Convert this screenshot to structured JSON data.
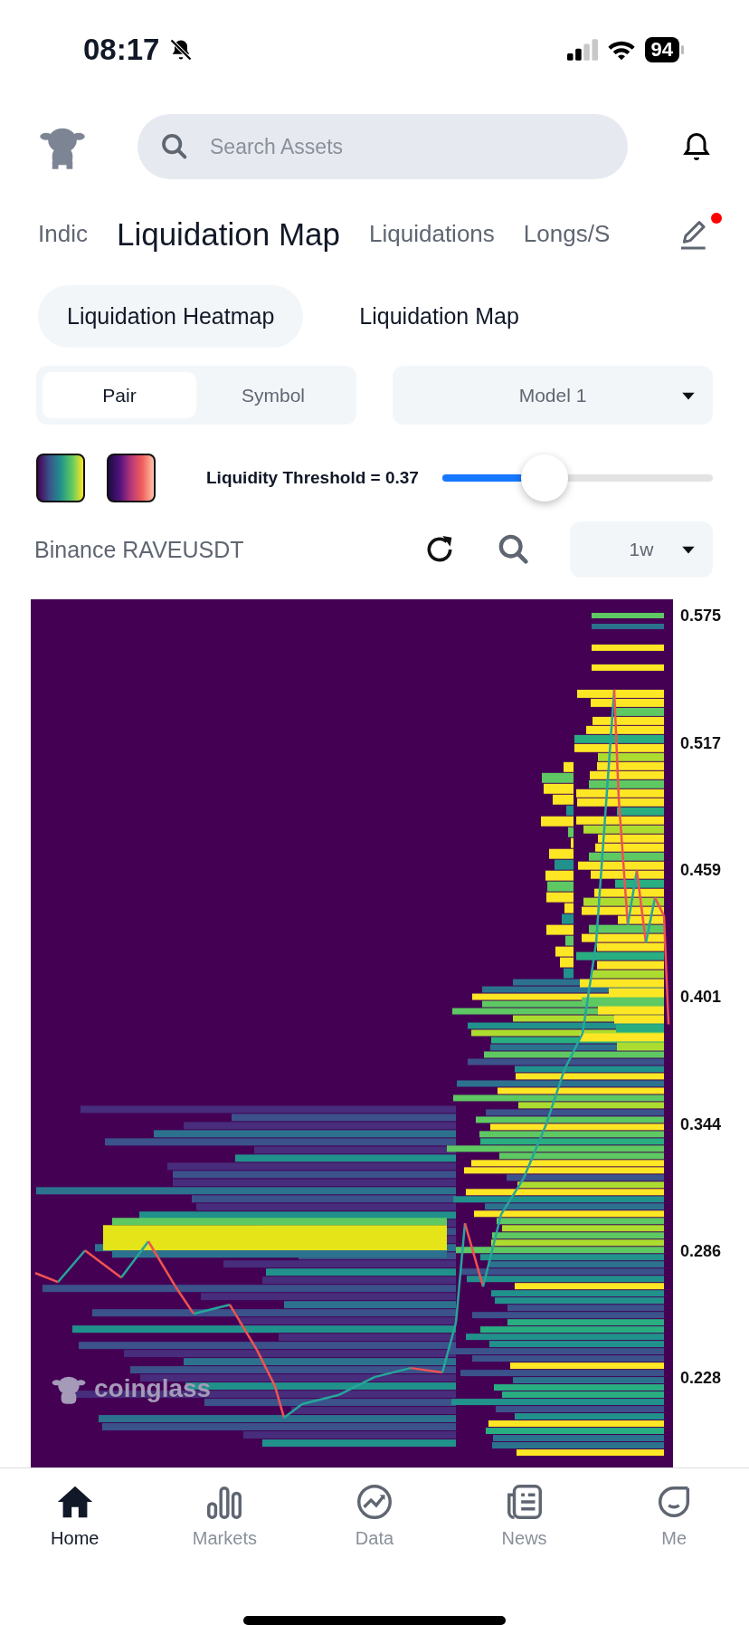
{
  "status_bar": {
    "time": "08:17",
    "battery": "94"
  },
  "header": {
    "search": {
      "placeholder": "Search Assets"
    }
  },
  "tabs": [
    {
      "label": "Indic",
      "selected": false
    },
    {
      "label": "Liquidation Map",
      "selected": true
    },
    {
      "label": "Liquidations",
      "selected": false
    },
    {
      "label": "Longs/S",
      "selected": false
    }
  ],
  "edit_button": {
    "has_notification": true
  },
  "view_toggle": [
    {
      "label": "Liquidation Heatmap",
      "selected": true
    },
    {
      "label": "Liquidation Map",
      "selected": false
    }
  ],
  "scope_toggle": [
    {
      "label": "Pair",
      "selected": true
    },
    {
      "label": "Symbol",
      "selected": false
    }
  ],
  "model_dropdown": {
    "value": "Model 1"
  },
  "color_schemes": [
    {
      "kind": "viridis"
    },
    {
      "kind": "magma"
    }
  ],
  "threshold": {
    "label": "Liquidity Threshold = 0.37",
    "level": 0.37
  },
  "instrument": "Binance RAVEUSDT",
  "interval_dropdown": {
    "value": "1w"
  },
  "chart": {
    "price_axis": [
      "0.575",
      "0.517",
      "0.459",
      "0.401",
      "0.344",
      "0.286",
      "0.228"
    ],
    "watermark": "coinglass"
  },
  "bottom_nav": [
    {
      "label": "Home",
      "selected": true
    },
    {
      "label": "Markets",
      "selected": false
    },
    {
      "label": "Data",
      "selected": false
    },
    {
      "label": "News",
      "selected": false
    },
    {
      "label": "Me",
      "selected": false
    }
  ]
}
